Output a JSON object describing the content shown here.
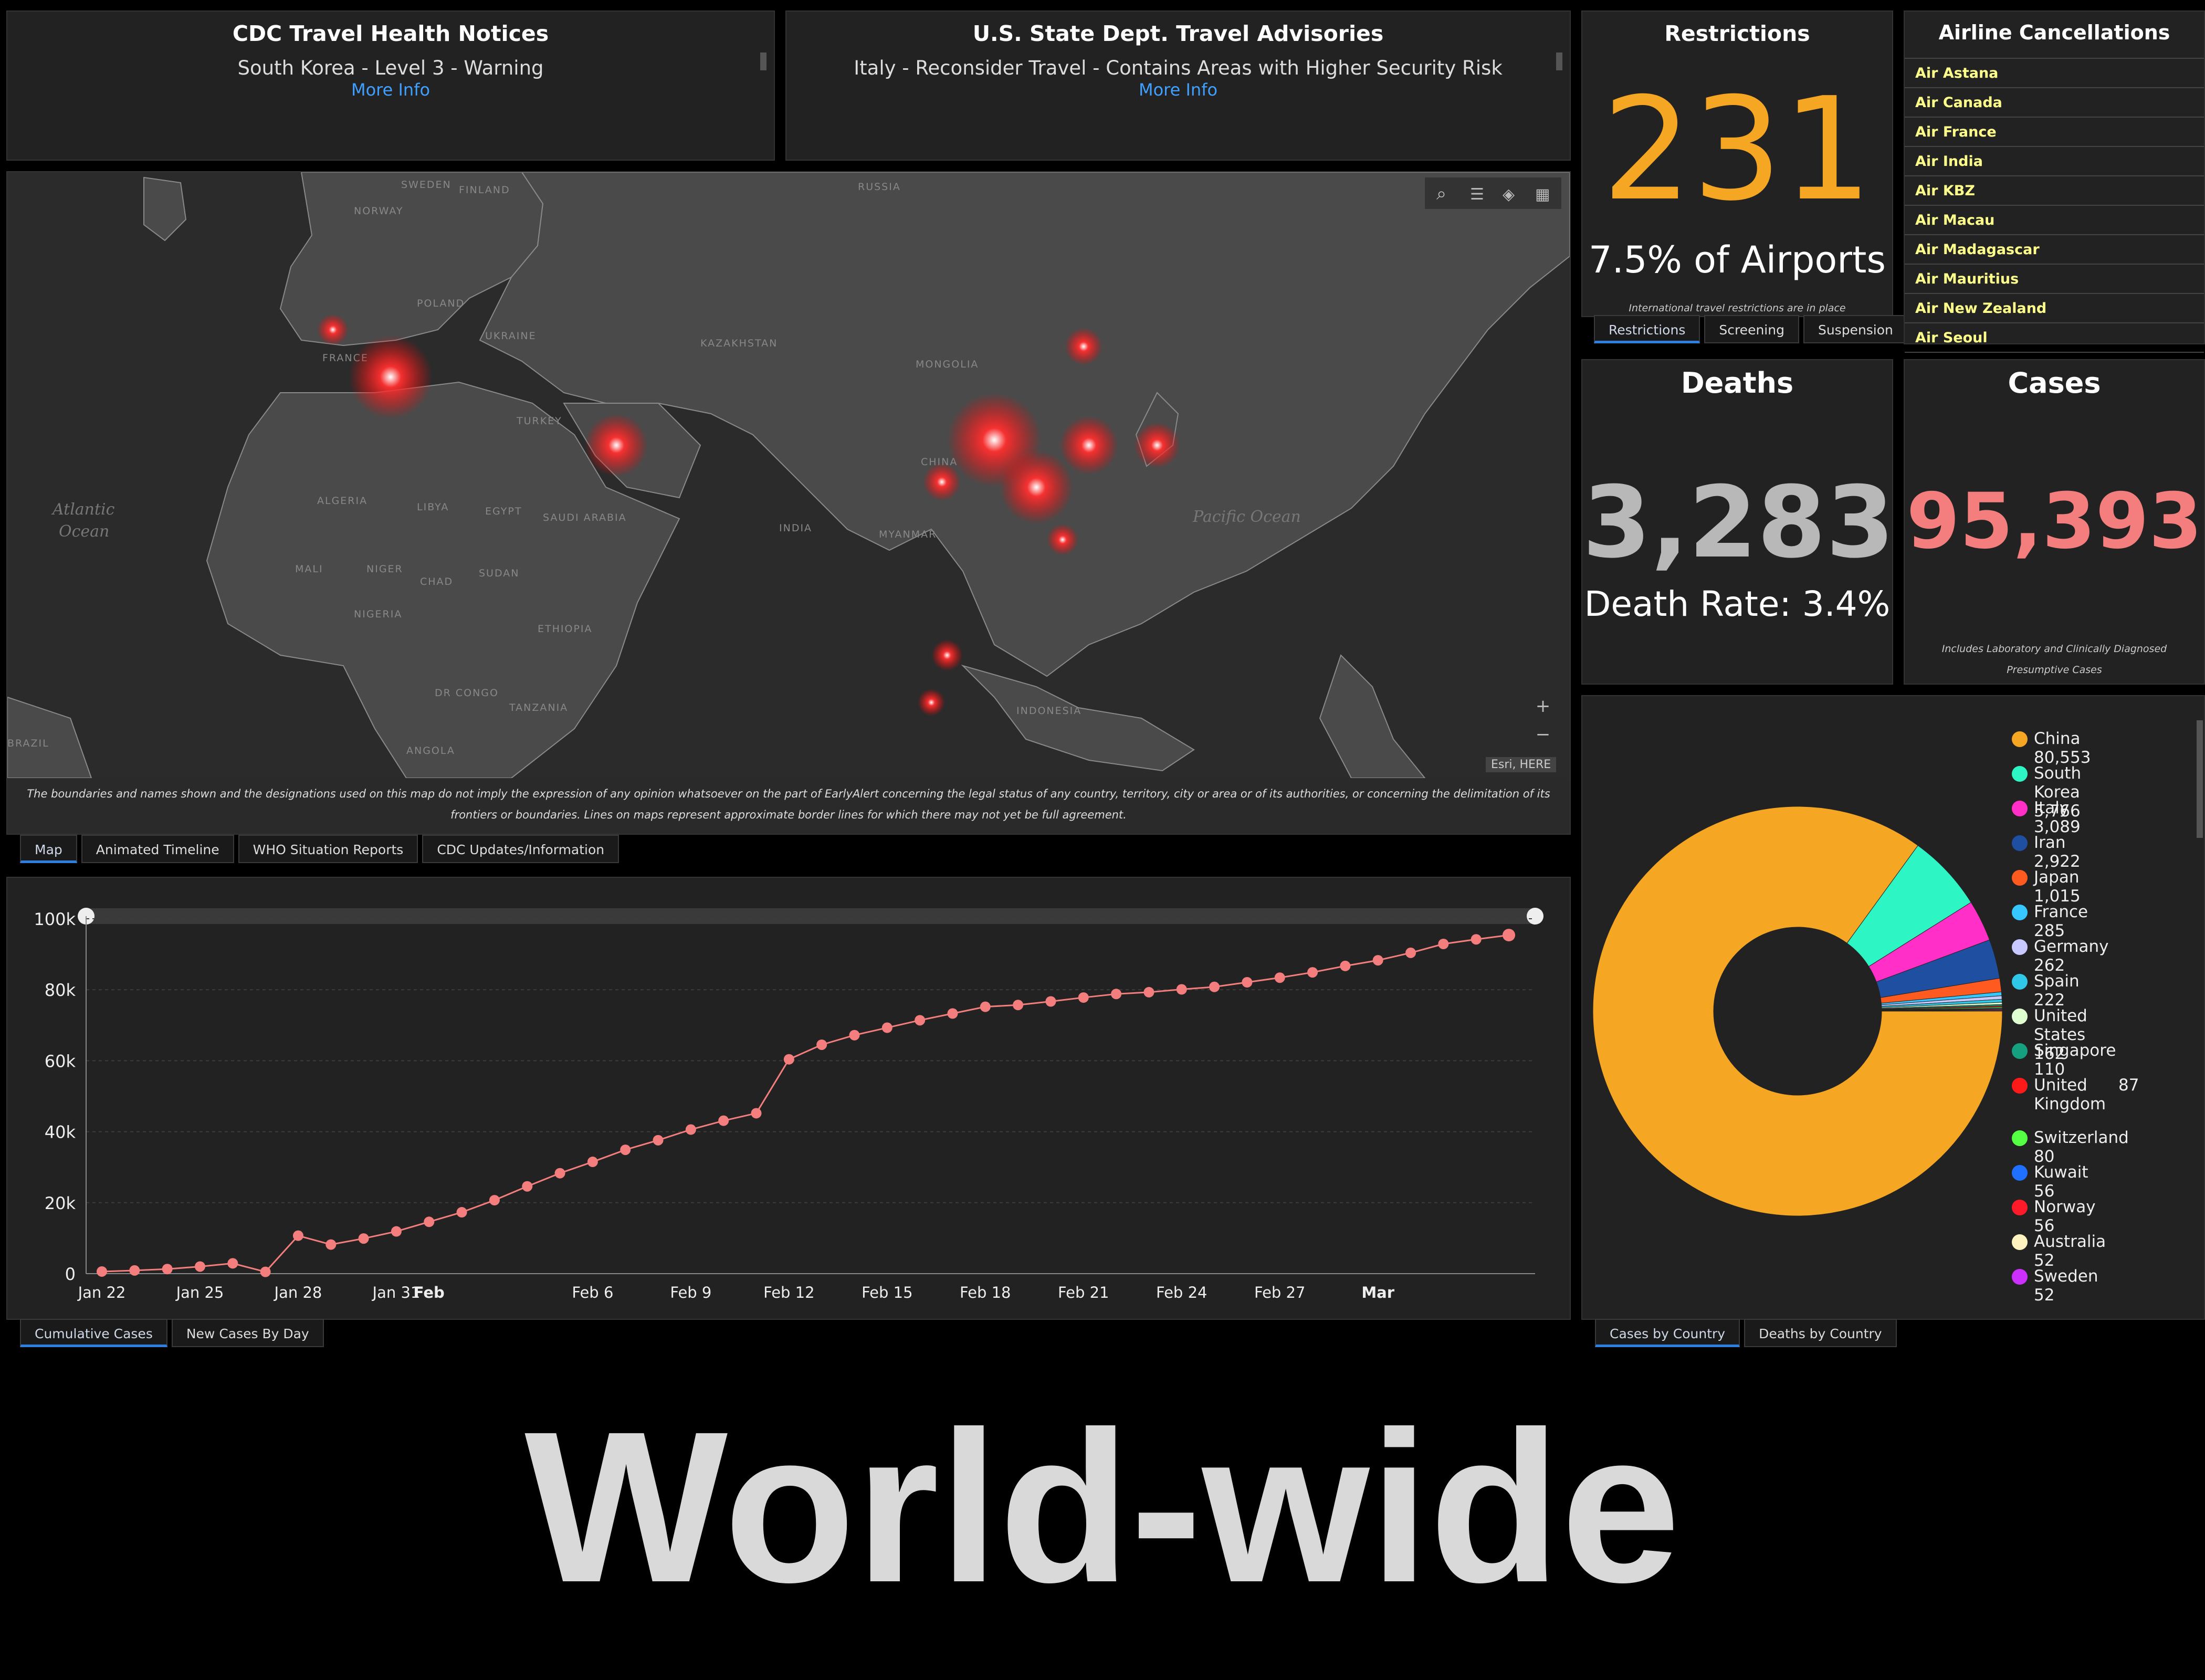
{
  "cdc": {
    "title": "CDC Travel Health Notices",
    "notice": "South Korea - Level 3 - Warning",
    "link": "More Info"
  },
  "state": {
    "title": "U.S. State Dept. Travel Advisories",
    "notice": "Italy - Reconsider Travel - Contains Areas with Higher Security Risk",
    "link": "More Info"
  },
  "restrictions": {
    "title": "Restrictions",
    "value": "231",
    "airports": "7.5% of Airports",
    "note": "International travel restrictions are in place",
    "tabs": [
      "Restrictions",
      "Screening",
      "Suspension"
    ],
    "value_color": "#f5a623"
  },
  "airlines": {
    "title": "Airline Cancellations",
    "items": [
      "Air Astana",
      "Air Canada",
      "Air France",
      "Air India",
      "Air KBZ",
      "Air Macau",
      "Air Madagascar",
      "Air Mauritius",
      "Air New Zealand",
      "Air Seoul"
    ]
  },
  "deaths": {
    "title": "Deaths",
    "value": "3,283",
    "rate": "Death Rate: 3.4%"
  },
  "cases": {
    "title": "Cases",
    "value": "95,393",
    "note": "Includes Laboratory and Clinically Diagnosed Presumptive Cases",
    "value_color": "#f47e7e"
  },
  "map": {
    "disclaimer": "The boundaries and names shown and the designations used on this map do not imply the expression of any opinion whatsoever on the part of EarlyAlert concerning the legal status of any country, territory, city or area or of its authorities, or concerning the delimitation of its frontiers or boundaries. Lines on maps represent approximate border lines for which there may not yet be full agreement.",
    "attribution": "Esri, HERE",
    "labels": [
      "SWEDEN",
      "FINLAND",
      "RUSSIA",
      "NORWAY",
      "POLAND",
      "UKRAINE",
      "FRANCE",
      "KAZAKHSTAN",
      "MONGOLIA",
      "TURKEY",
      "CHINA",
      "ALGERIA",
      "LIBYA",
      "EGYPT",
      "SAUDI ARABIA",
      "INDIA",
      "MALI",
      "NIGER",
      "CHAD",
      "SUDAN",
      "NIGERIA",
      "ETHIOPIA",
      "DR CONGO",
      "TANZANIA",
      "ANGOLA",
      "INDONESIA",
      "MYANMAR",
      "BRAZIL"
    ],
    "oceans": [
      "Atlantic",
      "Ocean",
      "Pacific Ocean"
    ],
    "tabs": [
      "Map",
      "Animated Timeline",
      "WHO Situation Reports",
      "CDC Updates/Information"
    ],
    "zoom_in": "+",
    "zoom_out": "−"
  },
  "line_tabs": [
    "Cumulative Cases",
    "New Cases By Day"
  ],
  "pie_tabs": [
    "Cases by Country",
    "Deaths by Country"
  ],
  "banner": "World-wide",
  "chart_data": [
    {
      "type": "line",
      "title": "",
      "xlabel": "",
      "ylabel": "",
      "x_tick_labels": [
        "Jan 22",
        "Jan 25",
        "Jan 28",
        "Jan 31",
        "Feb",
        "Feb 6",
        "Feb 9",
        "Feb 12",
        "Feb 15",
        "Feb 18",
        "Feb 21",
        "Feb 24",
        "Feb 27",
        "Mar"
      ],
      "y_tick_labels": [
        "0",
        "20k",
        "40k",
        "60k",
        "80k",
        "100k"
      ],
      "ylim": [
        0,
        100000
      ],
      "grid": true,
      "color": "#f47e7e",
      "x": [
        "Jan 22",
        "Jan 23",
        "Jan 24",
        "Jan 25",
        "Jan 26",
        "Jan 27",
        "Jan 28",
        "Jan 29",
        "Jan 30",
        "Jan 31",
        "Feb 1",
        "Feb 2",
        "Feb 3",
        "Feb 4",
        "Feb 5",
        "Feb 6",
        "Feb 7",
        "Feb 8",
        "Feb 9",
        "Feb 10",
        "Feb 11",
        "Feb 12",
        "Feb 13",
        "Feb 14",
        "Feb 15",
        "Feb 16",
        "Feb 17",
        "Feb 18",
        "Feb 19",
        "Feb 20",
        "Feb 21",
        "Feb 22",
        "Feb 23",
        "Feb 24",
        "Feb 25",
        "Feb 26",
        "Feb 27",
        "Feb 28",
        "Feb 29",
        "Mar 1",
        "Mar 2",
        "Mar 3",
        "Mar 4",
        "Mar 5"
      ],
      "values": [
        600,
        900,
        1300,
        2000,
        2900,
        500,
        10700,
        8200,
        9900,
        11900,
        14600,
        17300,
        20700,
        24600,
        28300,
        31500,
        34900,
        37600,
        40600,
        43100,
        45200,
        60400,
        64500,
        67200,
        69300,
        71400,
        73300,
        75200,
        75700,
        76700,
        77800,
        78800,
        79300,
        80100,
        80800,
        82100,
        83400,
        84900,
        86700,
        88300,
        90400,
        92900,
        94200,
        95400
      ]
    },
    {
      "type": "pie",
      "style": "donut",
      "legend": "right",
      "categories": [
        "China",
        "South Korea",
        "Italy",
        "Iran",
        "Japan",
        "France",
        "Germany",
        "Spain",
        "United States",
        "Singapore",
        "United Kingdom",
        "Switzerland",
        "Kuwait",
        "Norway",
        "Australia",
        "Sweden"
      ],
      "values": [
        80553,
        5766,
        3089,
        2922,
        1015,
        285,
        262,
        222,
        162,
        110,
        87,
        80,
        56,
        56,
        52,
        52
      ],
      "colors": [
        "#f5a623",
        "#2ef5c4",
        "#ff2fc7",
        "#1f4fa0",
        "#ff5a1f",
        "#36c7ff",
        "#c9c9ff",
        "#30c8e8",
        "#e0ffd0",
        "#15a080",
        "#ff1a1a",
        "#55ff44",
        "#2070ff",
        "#ff1a2a",
        "#fff4c0",
        "#cc30ff"
      ],
      "legend_labels": [
        "China 80,553",
        "South Korea 5,766",
        "Italy 3,089",
        "Iran 2,922",
        "Japan 1,015",
        "France 285",
        "Germany 262",
        "Spain 222",
        "United States 162",
        "Singapore 110",
        "United      87 Kingdom",
        "Switzerland 80",
        "Kuwait 56",
        "Norway 56",
        "Australia 52",
        "Sweden 52"
      ]
    }
  ]
}
